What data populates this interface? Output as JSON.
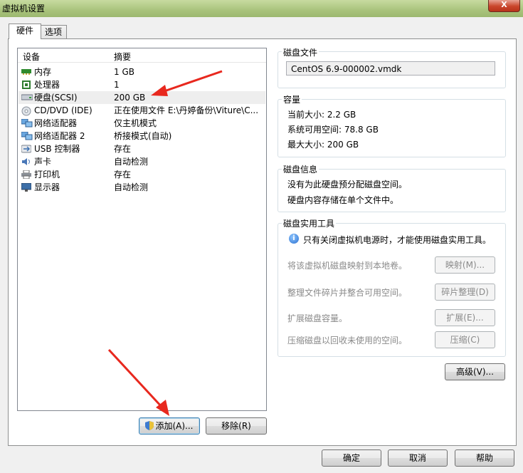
{
  "window": {
    "title": "虚拟机设置",
    "close_label": "X"
  },
  "tabs": [
    {
      "label": "硬件"
    },
    {
      "label": "选项"
    }
  ],
  "device_list": {
    "headers": {
      "device": "设备",
      "summary": "摘要"
    },
    "rows": [
      {
        "icon": "memory-icon",
        "device": "内存",
        "summary": "1 GB",
        "selected": false
      },
      {
        "icon": "processor-icon",
        "device": "处理器",
        "summary": "1",
        "selected": false
      },
      {
        "icon": "hard-disk-icon",
        "device": "硬盘(SCSI)",
        "summary": "200 GB",
        "selected": true
      },
      {
        "icon": "cd-dvd-icon",
        "device": "CD/DVD (IDE)",
        "summary": "正在使用文件 E:\\丹婷备份\\Viture\\C...",
        "selected": false
      },
      {
        "icon": "network-adapter-icon",
        "device": "网络适配器",
        "summary": "仅主机模式",
        "selected": false
      },
      {
        "icon": "network-adapter-icon",
        "device": "网络适配器 2",
        "summary": "桥接模式(自动)",
        "selected": false
      },
      {
        "icon": "usb-controller-icon",
        "device": "USB 控制器",
        "summary": "存在",
        "selected": false
      },
      {
        "icon": "sound-card-icon",
        "device": "声卡",
        "summary": "自动检测",
        "selected": false
      },
      {
        "icon": "printer-icon",
        "device": "打印机",
        "summary": "存在",
        "selected": false
      },
      {
        "icon": "display-icon",
        "device": "显示器",
        "summary": "自动检测",
        "selected": false
      }
    ]
  },
  "list_buttons": {
    "add": "添加(A)...",
    "remove": "移除(R)"
  },
  "disk_file": {
    "title": "磁盘文件",
    "value": "CentOS 6.9-000002.vmdk"
  },
  "capacity": {
    "title": "容量",
    "current": "当前大小: 2.2 GB",
    "available": "系统可用空间: 78.8 GB",
    "max": "最大大小: 200 GB"
  },
  "disk_info": {
    "title": "磁盘信息",
    "line1": "没有为此硬盘预分配磁盘空间。",
    "line2": "硬盘内容存储在单个文件中。"
  },
  "disk_utilities": {
    "title": "磁盘实用工具",
    "notice": "只有关闭虚拟机电源时，才能使用磁盘实用工具。",
    "items": [
      {
        "text": "将该虚拟机磁盘映射到本地卷。",
        "button": "映射(M)..."
      },
      {
        "text": "整理文件碎片并整合可用空间。",
        "button": "碎片整理(D)"
      },
      {
        "text": "扩展磁盘容量。",
        "button": "扩展(E)..."
      },
      {
        "text": "压缩磁盘以回收未使用的空间。",
        "button": "压缩(C)"
      }
    ]
  },
  "advanced_button": "高级(V)...",
  "dialog_buttons": {
    "ok": "确定",
    "cancel": "取消",
    "help": "帮助"
  },
  "colors": {
    "annotation_arrow": "#e8281e",
    "title_bar": "#a9c37c"
  }
}
